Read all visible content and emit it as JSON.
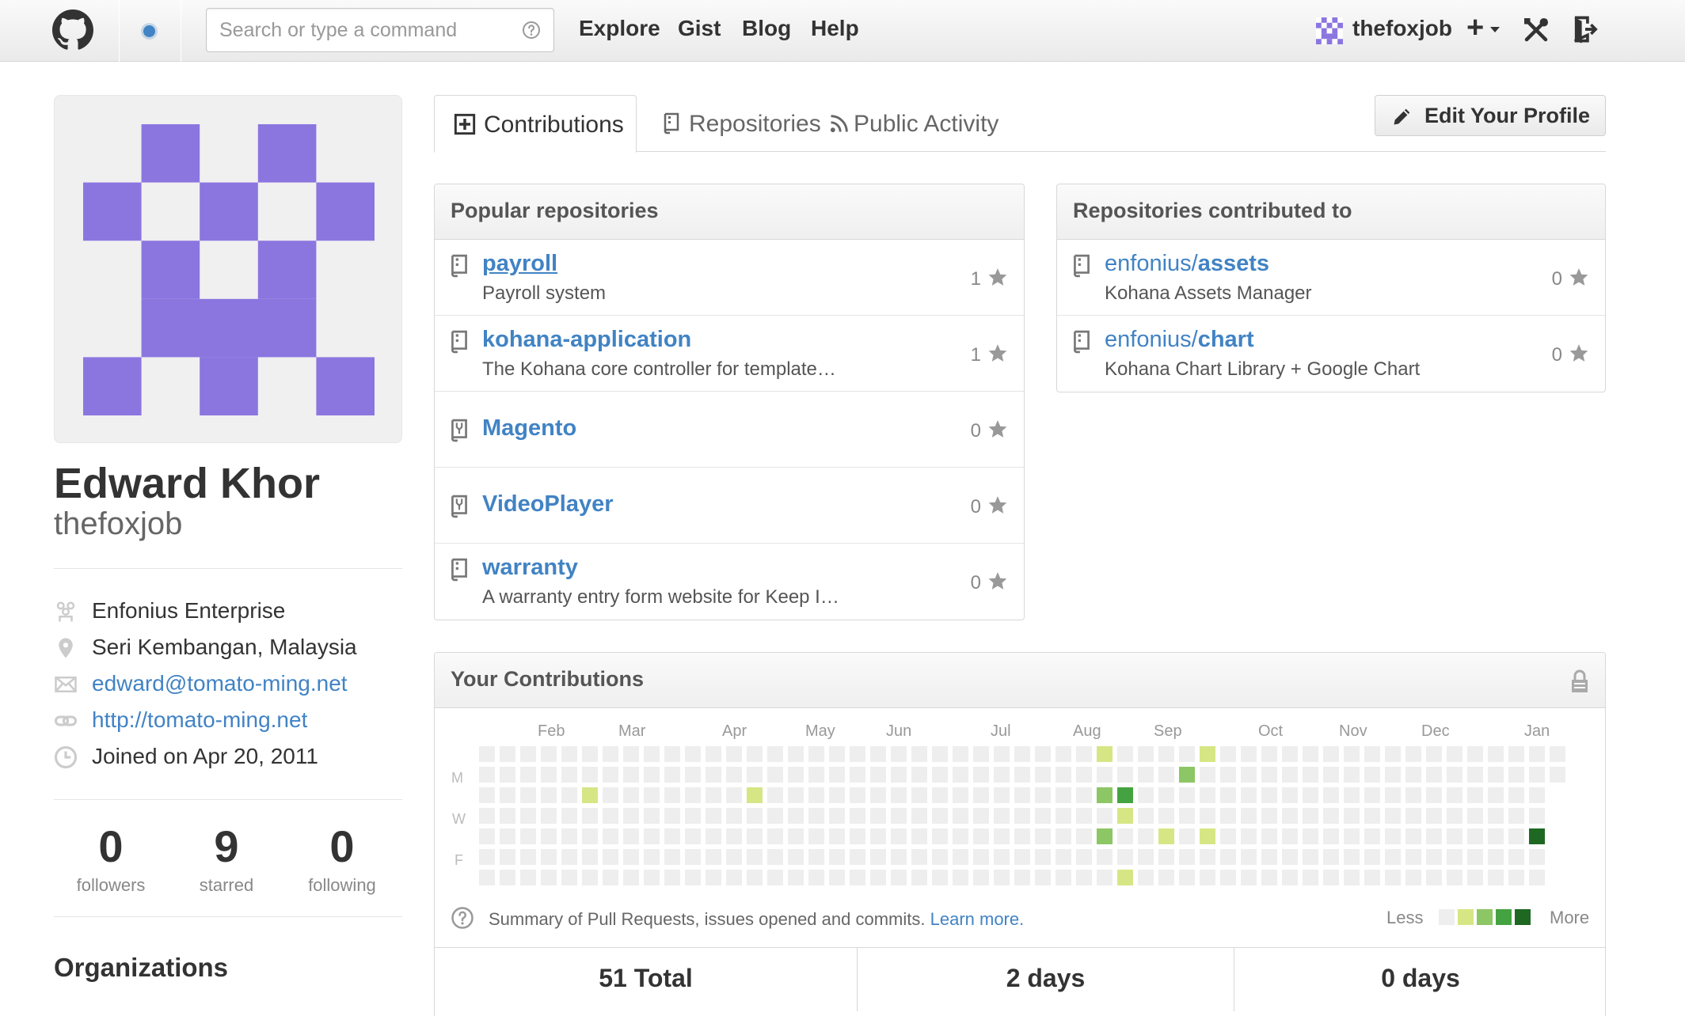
{
  "header": {
    "search_placeholder": "Search or type a command",
    "nav": [
      "Explore",
      "Gist",
      "Blog",
      "Help"
    ],
    "username": "thefoxjob",
    "plus": "+"
  },
  "profile": {
    "fullname": "Edward Khor",
    "login": "thefoxjob",
    "vcard": {
      "organization": "Enfonius Enterprise",
      "location": "Seri Kembangan, Malaysia",
      "email": "edward@tomato-ming.net",
      "url": "http://tomato-ming.net",
      "joined": "Joined on Apr 20, 2011"
    },
    "stats": [
      {
        "value": "0",
        "label": "followers"
      },
      {
        "value": "9",
        "label": "starred"
      },
      {
        "value": "0",
        "label": "following"
      }
    ],
    "organizations_title": "Organizations",
    "avatar_color": "#8b76e0"
  },
  "tabs": [
    {
      "label": "Contributions",
      "icon": "contributions-icon",
      "active": true
    },
    {
      "label": "Repositories",
      "icon": "repo-icon",
      "active": false
    },
    {
      "label": "Public Activity",
      "icon": "rss-icon",
      "active": false
    }
  ],
  "edit_profile_label": "Edit Your Profile",
  "popular": {
    "title": "Popular repositories",
    "repos": [
      {
        "name": "payroll",
        "desc": "Payroll system",
        "stars": "1",
        "icon": "repo-icon"
      },
      {
        "name": "kohana-application",
        "desc": "The Kohana core controller for template…",
        "stars": "1",
        "icon": "repo-icon"
      },
      {
        "name": "Magento",
        "desc": "",
        "stars": "0",
        "icon": "repo-forked-icon"
      },
      {
        "name": "VideoPlayer",
        "desc": "",
        "stars": "0",
        "icon": "repo-forked-icon"
      },
      {
        "name": "warranty",
        "desc": "A warranty entry form website for Keep I…",
        "stars": "0",
        "icon": "repo-icon"
      }
    ]
  },
  "contributed": {
    "title": "Repositories contributed to",
    "repos": [
      {
        "owner": "enfonius/",
        "name": "assets",
        "desc": "Kohana Assets Manager",
        "stars": "0"
      },
      {
        "owner": "enfonius/",
        "name": "chart",
        "desc": "Kohana Chart Library + Google Chart",
        "stars": "0"
      }
    ]
  },
  "contributions": {
    "title": "Your Contributions",
    "months": [
      "Feb",
      "Mar",
      "Apr",
      "May",
      "Jun",
      "Jul",
      "Aug",
      "Sep",
      "Oct",
      "Nov",
      "Dec",
      "Jan"
    ],
    "days": [
      "M",
      "W",
      "F"
    ],
    "summary": "Summary of Pull Requests, issues opened and commits.",
    "learn_more": "Learn more.",
    "legend_less": "Less",
    "legend_more": "More",
    "legend_colors": [
      "#eeeeee",
      "#d6e685",
      "#8cc665",
      "#44a340",
      "#1e6823"
    ],
    "total": "51 Total",
    "longest_streak": "2 days",
    "current_streak": "0 days",
    "active_days": [
      {
        "week": 5,
        "day": 2,
        "level": 1
      },
      {
        "week": 13,
        "day": 2,
        "level": 1
      },
      {
        "week": 30,
        "day": 0,
        "level": 1
      },
      {
        "week": 30,
        "day": 2,
        "level": 2
      },
      {
        "week": 30,
        "day": 4,
        "level": 2
      },
      {
        "week": 31,
        "day": 2,
        "level": 3
      },
      {
        "week": 31,
        "day": 3,
        "level": 1
      },
      {
        "week": 31,
        "day": 6,
        "level": 1
      },
      {
        "week": 33,
        "day": 4,
        "level": 1
      },
      {
        "week": 34,
        "day": 1,
        "level": 2
      },
      {
        "week": 35,
        "day": 0,
        "level": 1
      },
      {
        "week": 35,
        "day": 4,
        "level": 1
      },
      {
        "week": 51,
        "day": 4,
        "level": 4
      }
    ]
  }
}
